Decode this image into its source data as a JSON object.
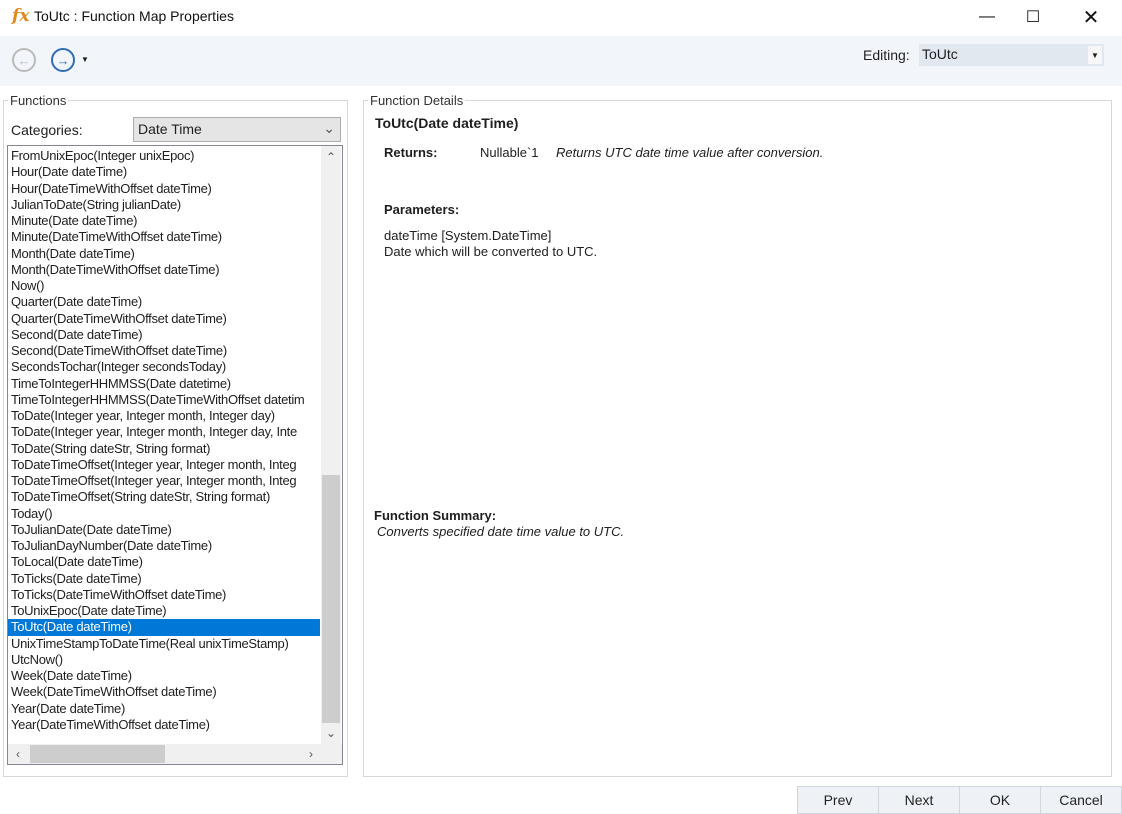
{
  "window": {
    "title": "ToUtc : Function Map Properties",
    "icon": "fx-icon"
  },
  "toolbar": {
    "editing_label": "Editing:",
    "editing_value": "ToUtc"
  },
  "functions": {
    "legend": "Functions",
    "categories_label": "Categories:",
    "category_value": "Date Time",
    "items": [
      "FromUnixEpoc(Integer unixEpoc)",
      "Hour(Date dateTime)",
      "Hour(DateTimeWithOffset dateTime)",
      "JulianToDate(String julianDate)",
      "Minute(Date dateTime)",
      "Minute(DateTimeWithOffset dateTime)",
      "Month(Date dateTime)",
      "Month(DateTimeWithOffset dateTime)",
      "Now()",
      "Quarter(Date dateTime)",
      "Quarter(DateTimeWithOffset dateTime)",
      "Second(Date dateTime)",
      "Second(DateTimeWithOffset dateTime)",
      "SecondsTochar(Integer secondsToday)",
      "TimeToIntegerHHMMSS(Date datetime)",
      "TimeToIntegerHHMMSS(DateTimeWithOffset datetim",
      "ToDate(Integer year, Integer month, Integer day)",
      "ToDate(Integer year, Integer month, Integer day, Inte",
      "ToDate(String dateStr, String format)",
      "ToDateTimeOffset(Integer year, Integer month, Integ",
      "ToDateTimeOffset(Integer year, Integer month, Integ",
      "ToDateTimeOffset(String dateStr, String format)",
      "Today()",
      "ToJulianDate(Date dateTime)",
      "ToJulianDayNumber(Date dateTime)",
      "ToLocal(Date dateTime)",
      "ToTicks(Date dateTime)",
      "ToTicks(DateTimeWithOffset dateTime)",
      "ToUnixEpoc(Date dateTime)",
      "ToUtc(Date dateTime)",
      "UnixTimeStampToDateTime(Real unixTimeStamp)",
      "UtcNow()",
      "Week(Date dateTime)",
      "Week(DateTimeWithOffset dateTime)",
      "Year(Date dateTime)",
      "Year(DateTimeWithOffset dateTime)"
    ],
    "selected_index": 29
  },
  "details": {
    "legend": "Function Details",
    "signature": "ToUtc(Date dateTime)",
    "returns_label": "Returns:",
    "returns_type": "Nullable`1",
    "returns_desc": "Returns UTC date time value after conversion.",
    "parameters_label": "Parameters:",
    "param_name": "dateTime [System.DateTime]",
    "param_desc": "Date which will be converted to UTC.",
    "summary_label": "Function Summary:",
    "summary_text": "Converts specified date time value to UTC."
  },
  "buttons": {
    "prev": "Prev",
    "next": "Next",
    "ok": "OK",
    "cancel": "Cancel"
  }
}
